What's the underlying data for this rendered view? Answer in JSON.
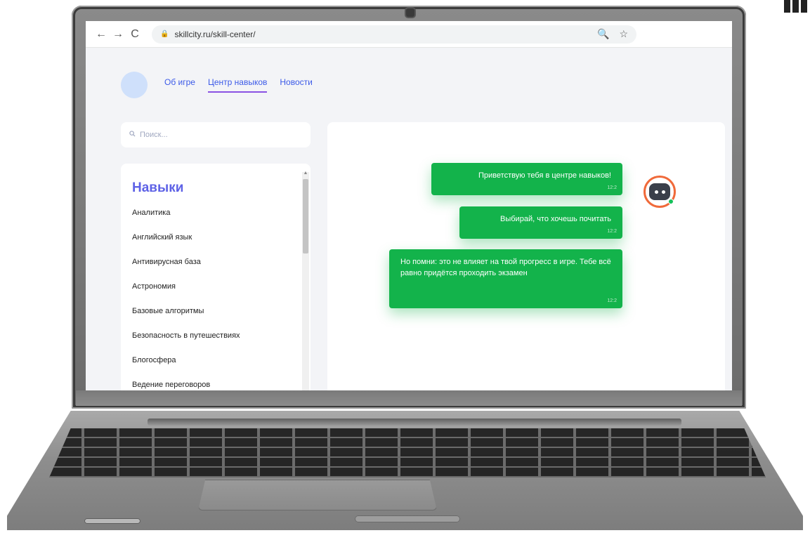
{
  "browser": {
    "url": "skillcity.ru/skill-center/",
    "back_icon": "←",
    "forward_icon": "→",
    "reload_icon": "C",
    "lock_icon": "🔒",
    "zoom_icon": "🔍",
    "star_icon": "☆"
  },
  "nav": {
    "items": [
      {
        "label": "Об игре",
        "active": false
      },
      {
        "label": "Центр навыков",
        "active": true
      },
      {
        "label": "Новости",
        "active": false
      }
    ]
  },
  "search": {
    "placeholder": "Поиск..."
  },
  "skills": {
    "title": "Навыки",
    "items": [
      "Аналитика",
      "Английский язык",
      "Антивирусная база",
      "Астрономия",
      "Базовые алгоритмы",
      "Безопасность в путешествиях",
      "Блогосфера",
      "Ведение переговоров"
    ]
  },
  "chat": {
    "messages": [
      {
        "text": "Приветствую тебя в центре навыков!",
        "time": "12:2"
      },
      {
        "text": "Выбирай, что хочешь почитать",
        "time": "12:2"
      },
      {
        "text": "Но помни: это не влияет на твой прогресс в игре. Тебе всё равно придётся проходить экзамен",
        "time": "12:2"
      }
    ]
  },
  "colors": {
    "accent_blue": "#3c5ae8",
    "title_purple": "#5e62e6",
    "bubble_green": "#13b34b",
    "underline": "#8a52e3"
  }
}
